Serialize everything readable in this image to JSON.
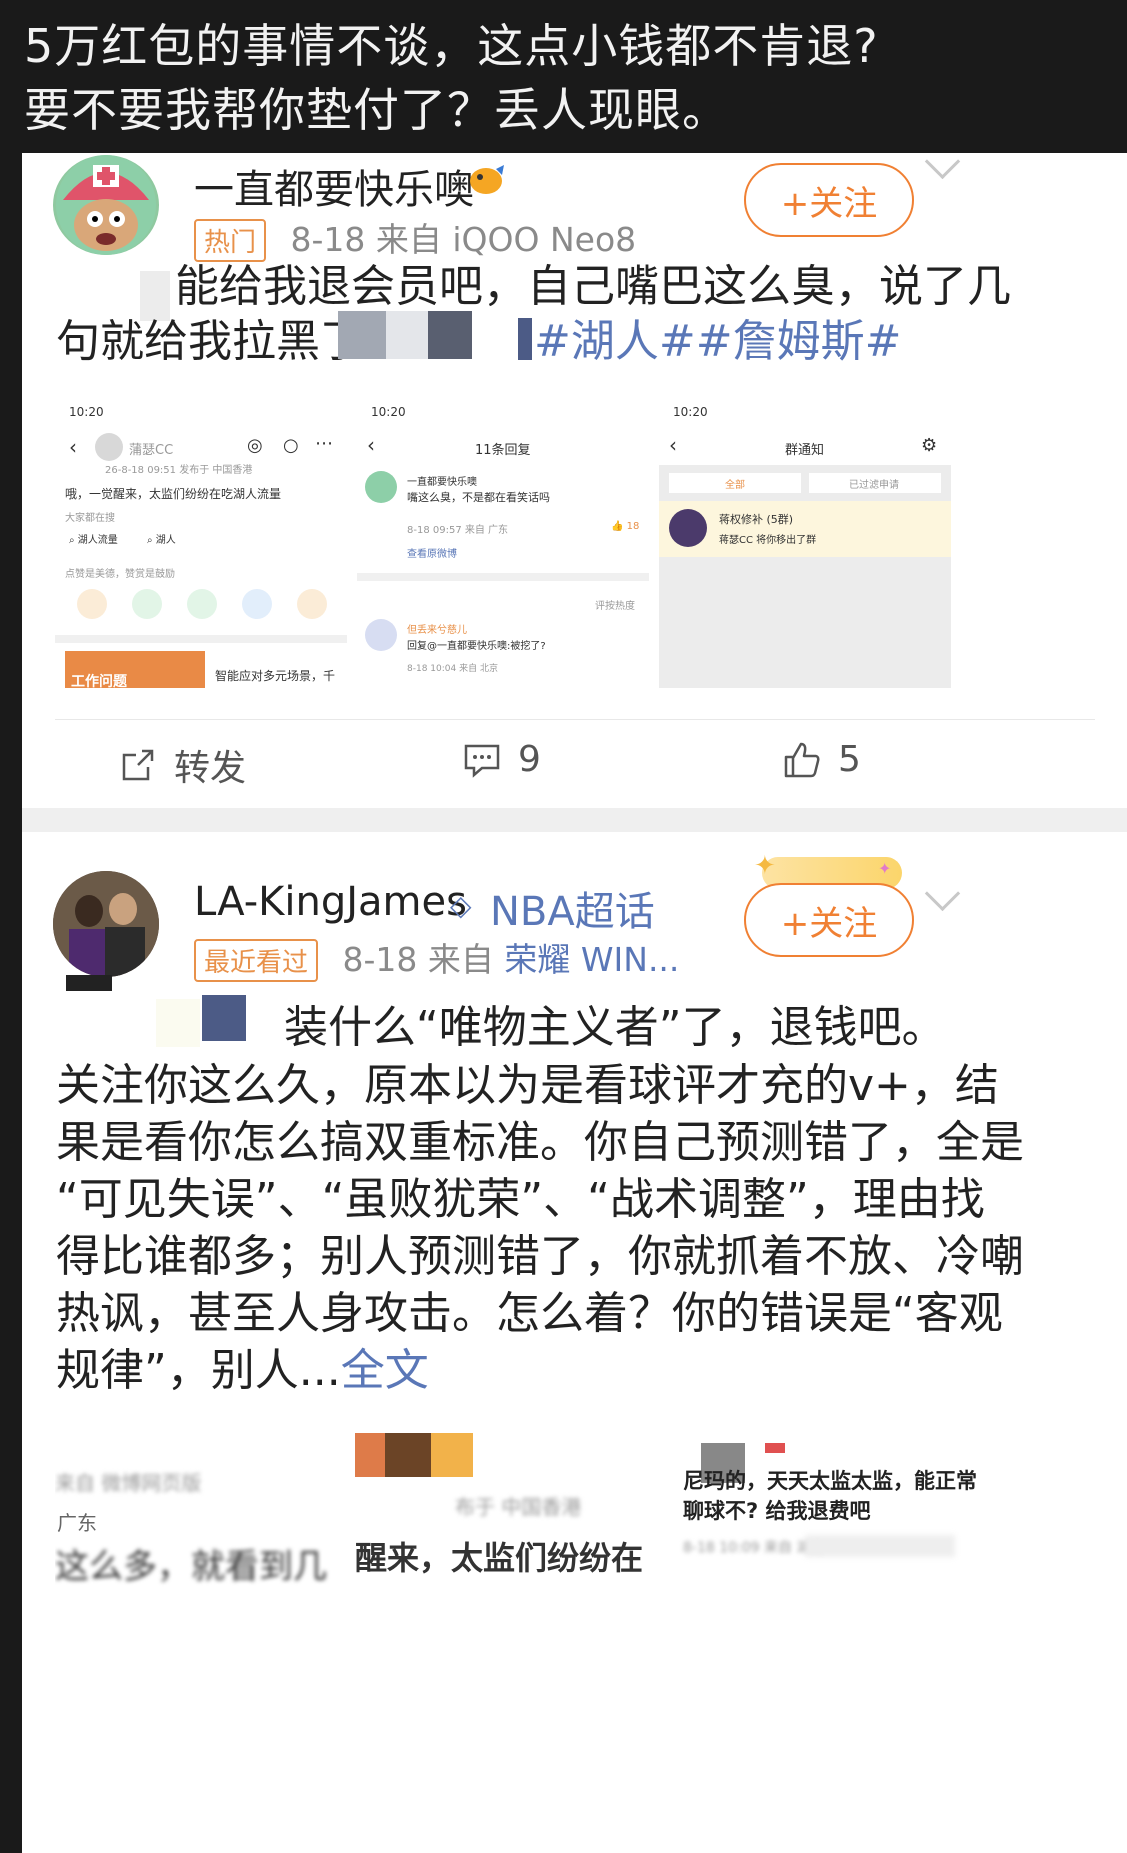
{
  "caption": {
    "line1": "5万红包的事情不谈，这点小钱都不肯退?",
    "line2": "要不要我帮你垫付了？丢人现眼。"
  },
  "post1": {
    "username": "一直都要快乐噢",
    "badge": "热门",
    "meta": "8-18 来自 iQOO Neo8",
    "follow": "+关注",
    "text_line1": "能给我退会员吧，自己嘴巴这么臭，说了几",
    "text_line2_a": "句就给我拉黑了",
    "text_line2_topic": "#湖人##詹姆斯#",
    "shot1": {
      "time": "10:20",
      "name": "蒲瑟CC",
      "meta": "26-8-18 09:51 发布于 中国香港",
      "text": "哦，一觉醒来，太监们纷纷在吃湖人流量",
      "sub": "大家都在搜",
      "chip1": "湖人流量",
      "chip2": "湖人",
      "fav": "点赞是美德，赞赏是鼓励",
      "bottom_tag": "工作问题",
      "bottom_text": "智能应对多元场景，千"
    },
    "shot2": {
      "time": "10:20",
      "title": "11条回复",
      "reply_name": "一直都要快乐噢",
      "reply_text": "嘴这么臭，不是都在看笑话吗",
      "reply_meta": "8-18 09:57 来自 广东",
      "reply_likes": "18",
      "view_orig": "查看原微博",
      "sort": "评按热度",
      "reply2_name": "但丢来兮慈儿",
      "reply2_text": "回复@一直都要快乐噢:被挖了?",
      "reply2_meta": "8-18 10:04 来自 北京"
    },
    "shot3": {
      "time": "10:20",
      "title": "群通知",
      "tab1": "全部",
      "tab2": "已过滤申请",
      "notice_title": "蒋权修补 (5群)",
      "notice_text": "蒋瑟CC 将你移出了群"
    },
    "actions": {
      "repost": "转发",
      "comments": "9",
      "likes": "5"
    }
  },
  "post2": {
    "username": "LA-KingJames",
    "super_topic": "NBA超话",
    "badge": "最近看过",
    "meta_a": "8-18 来自",
    "meta_b": "荣耀 WIN...",
    "follow": "+关注",
    "lines": [
      "装什么“唯物主义者”了，退钱吧。",
      "关注你这么久，原本以为是看球评才充的v+，结",
      "果是看你怎么搞双重标准。你自己预测错了，全是",
      "“可见失误”、“虽败犹荣”、“战术调整”，理由找",
      "得比谁都多；别人预测错了，你就抓着不放、冷嘲",
      "热讽，甚至人身攻击。怎么着？你的错误是“客观",
      "规律”，别人..."
    ],
    "more": "全文",
    "img_left_meta": "来自 微博网页版",
    "img_left_region": "广东",
    "img_left_text": "这么多，就看到几",
    "img_mid_meta": "布于 中国香港",
    "img_mid_text": "醒来，太监们纷纷在!",
    "img_right_text1": "尼玛的，天天太监太监，能正常",
    "img_right_text2": "聊球不? 给我退费吧",
    "img_right_meta": "8-18 10:09 来自 湖南"
  },
  "colors": {
    "accent_orange": "#f08033",
    "link_blue": "#5a77b7",
    "caption_bg": "#1a1a1a"
  }
}
